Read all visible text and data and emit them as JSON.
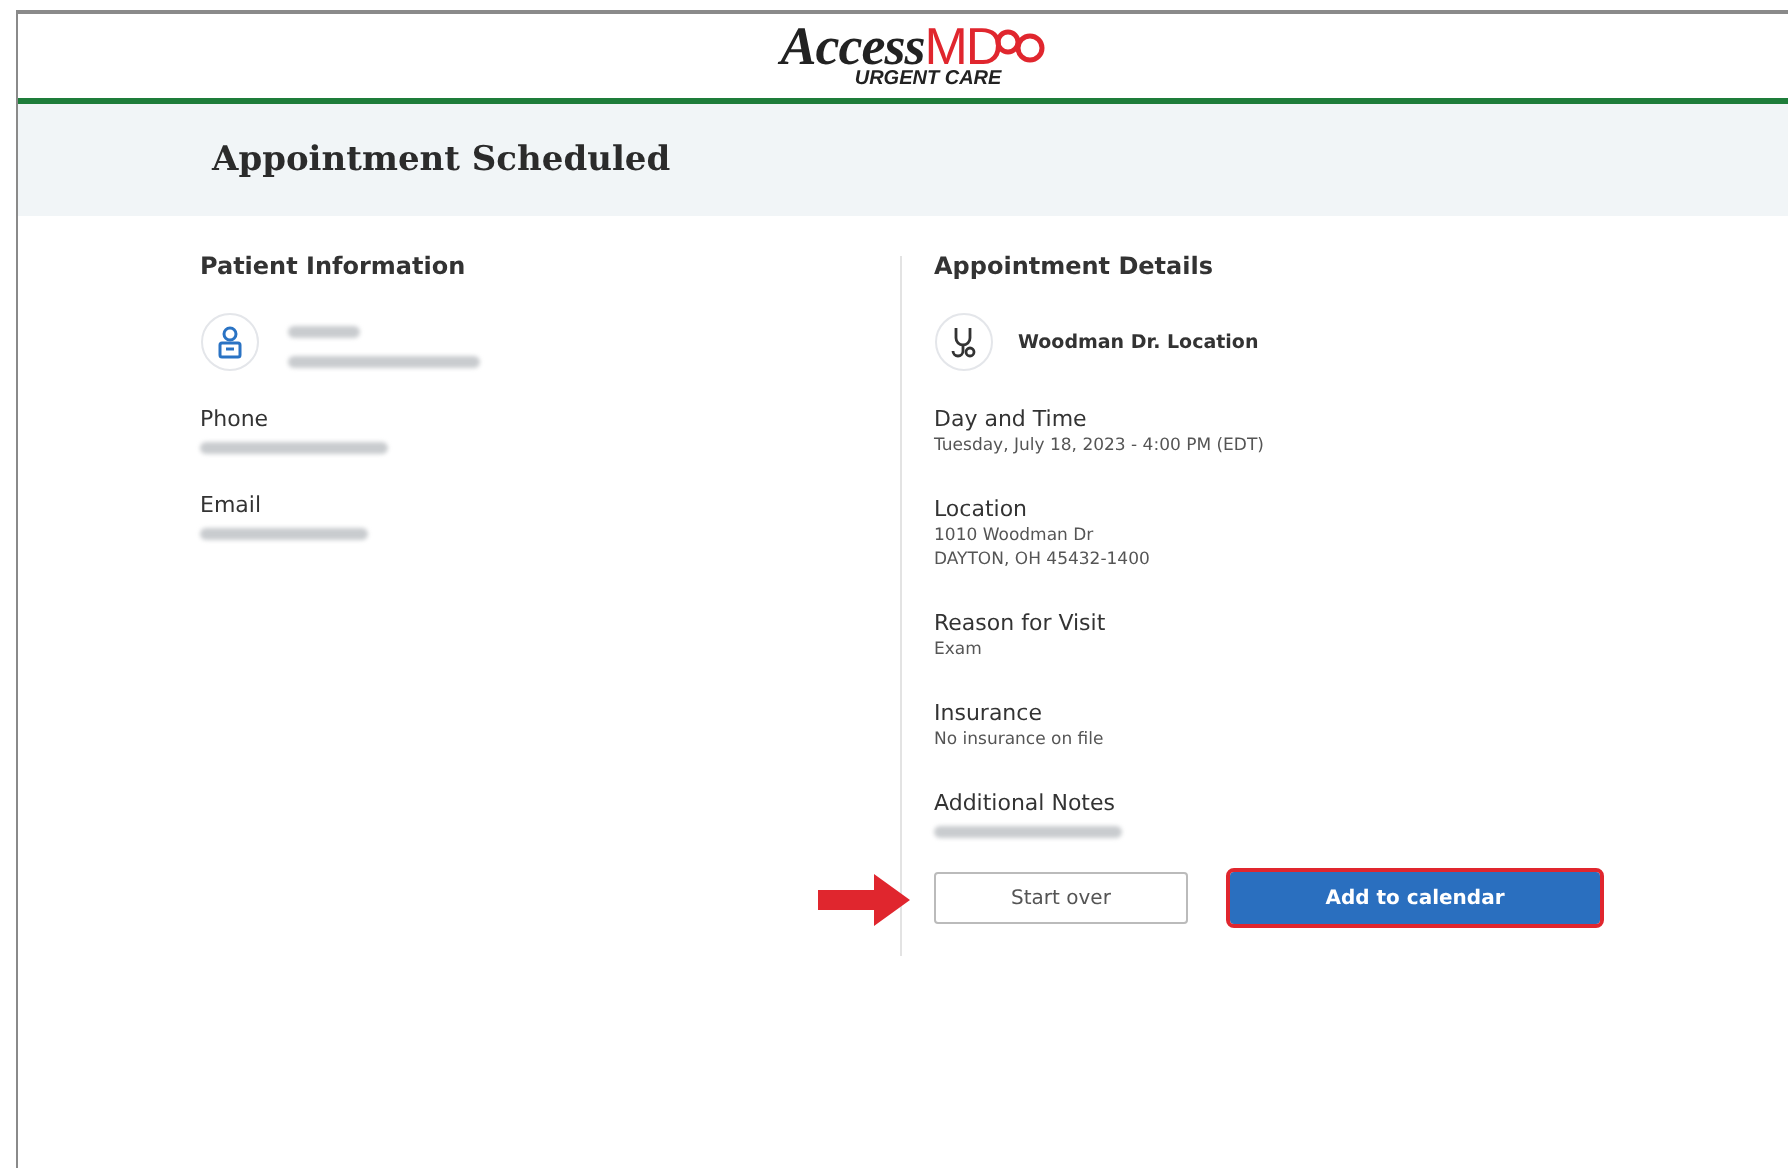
{
  "logo": {
    "brand_main": "Access",
    "brand_accent": "MD",
    "tagline": "URGENT CARE"
  },
  "page_title": "Appointment Scheduled",
  "patient": {
    "heading": "Patient Information",
    "card": {
      "name_blurred": true,
      "details_blurred": true
    },
    "fields": [
      {
        "label": "Phone",
        "blurred": true
      },
      {
        "label": "Email",
        "blurred": true
      }
    ]
  },
  "appointment": {
    "heading": "Appointment Details",
    "location_name": "Woodman Dr. Location",
    "fields": [
      {
        "label": "Day and Time",
        "lines": [
          "Tuesday, July 18, 2023 - 4:00 PM (EDT)"
        ]
      },
      {
        "label": "Location",
        "lines": [
          "1010 Woodman Dr",
          "DAYTON, OH 45432-1400"
        ]
      },
      {
        "label": "Reason for Visit",
        "lines": [
          "Exam"
        ]
      },
      {
        "label": "Insurance",
        "lines": [
          "No insurance on file"
        ]
      },
      {
        "label": "Additional Notes",
        "blurred": true
      }
    ]
  },
  "buttons": [
    {
      "label": "Start over",
      "kind": "secondary",
      "pointed_at": true,
      "highlighted": false
    },
    {
      "label": "Add to calendar",
      "kind": "primary",
      "pointed_at": false,
      "highlighted": true
    }
  ]
}
